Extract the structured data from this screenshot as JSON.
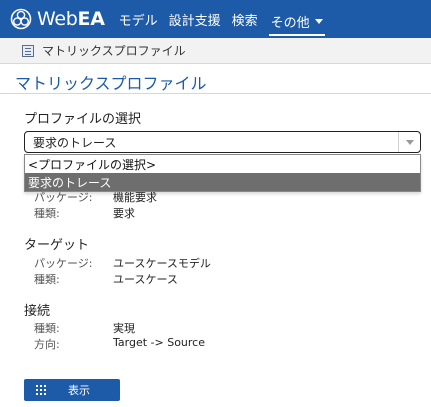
{
  "app": {
    "logo_web": "Web",
    "logo_ea": "EA",
    "logo_icon": "webea-logo-icon",
    "accent": "#1d5aa8"
  },
  "nav": {
    "items": [
      {
        "label": "モデル"
      },
      {
        "label": "設計支援"
      },
      {
        "label": "検索"
      },
      {
        "label": "その他"
      }
    ]
  },
  "breadcrumb": {
    "icon": "matrix-profile-icon",
    "label": "マトリックスプロファイル"
  },
  "page": {
    "title": "マトリックスプロファイル"
  },
  "profile_select": {
    "heading": "プロファイルの選択",
    "value": "要求のトレース",
    "options": [
      {
        "label": "<プロファイルの選択>"
      },
      {
        "label": "要求のトレース"
      }
    ]
  },
  "source": {
    "package_key": "パッケージ:",
    "package_value": "機能要求",
    "type_key": "種類:",
    "type_value": "要求"
  },
  "target": {
    "heading": "ターゲット",
    "package_key": "パッケージ:",
    "package_value": "ユースケースモデル",
    "type_key": "種類:",
    "type_value": "ユースケース"
  },
  "connection": {
    "heading": "接続",
    "type_key": "種類:",
    "type_value": "実現",
    "direction_key": "方向:",
    "direction_value": "Target -> Source"
  },
  "actions": {
    "show_label": "表示",
    "show_icon": "grid-icon"
  }
}
